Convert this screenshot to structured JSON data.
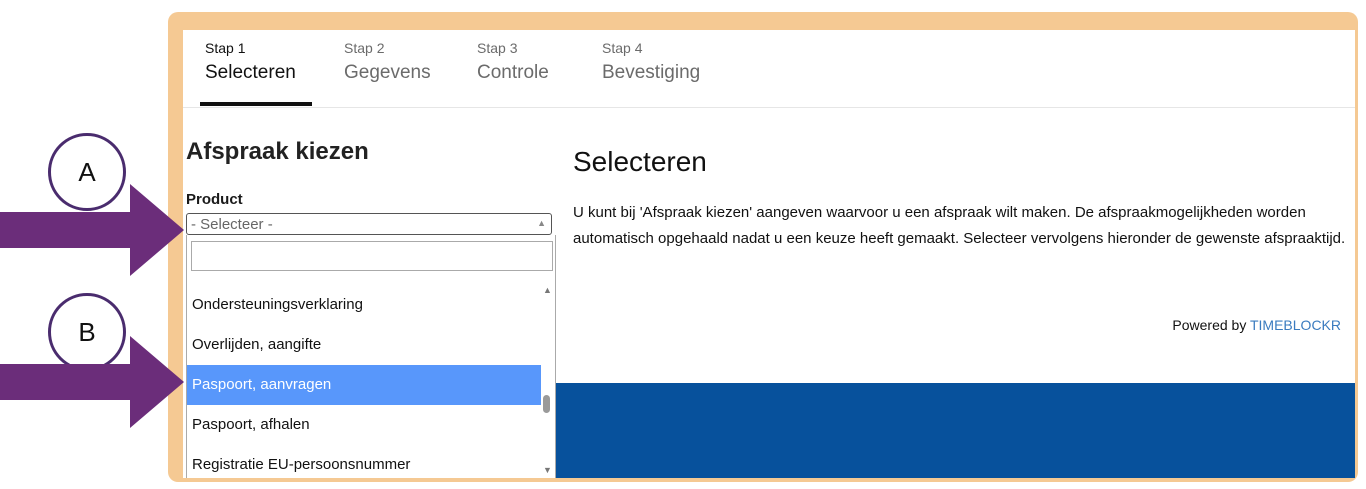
{
  "steps": [
    {
      "num": "Stap 1",
      "name": "Selecteren"
    },
    {
      "num": "Stap 2",
      "name": "Gegevens"
    },
    {
      "num": "Stap 3",
      "name": "Controle"
    },
    {
      "num": "Stap 4",
      "name": "Bevestiging"
    }
  ],
  "left": {
    "title": "Afspraak kiezen",
    "product_label": "Product",
    "select_value": "- Selecteer -",
    "dropdown_items": [
      "Ondersteuningsverklaring",
      "Overlijden, aangifte",
      "Paspoort, aanvragen",
      "Paspoort, afhalen",
      "Registratie EU-persoonsnummer"
    ],
    "selected_item": "Paspoort, aanvragen"
  },
  "main": {
    "title": "Selecteren",
    "text": "U kunt bij 'Afspraak kiezen' aangeven waarvoor u een afspraak wilt maken. De afspraakmogelijkheden worden automatisch opgehaald nadat u een keuze heeft gemaakt. Selecteer vervolgens hieronder de gewenste afspraaktijd.",
    "powered_by": "Powered by",
    "brand": "TIMEBLOCKR"
  },
  "annotations": {
    "a": "A",
    "b": "B"
  },
  "colors": {
    "frame": "#f5c993",
    "selected": "#5897fb",
    "band": "#07519c",
    "arrow": "#6b2d7a"
  }
}
